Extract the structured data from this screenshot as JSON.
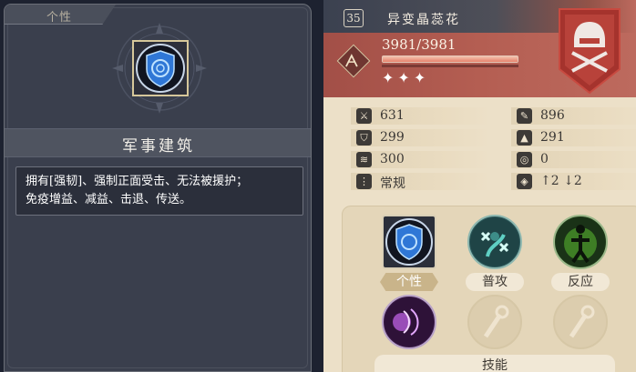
{
  "trait_panel": {
    "tab_label": "个性",
    "name": "军事建筑",
    "description_line1": "拥有[强韧]、强制正面受击、无法被援护；",
    "description_line2": "免疫增益、减益、击退、传送。"
  },
  "unit": {
    "level": "35",
    "name": "异变晶蕊花",
    "hp_text": "3981/3981",
    "hp_fraction": 1.0,
    "stars": "✦✦✦",
    "header_color": "#b45e52"
  },
  "stats": {
    "attack": "631",
    "magic_attack": "896",
    "defense": "299",
    "magic_defense": "291",
    "move": "300",
    "attack_range": "0",
    "move_type": "常规",
    "height_range": "↑2 ↓2"
  },
  "skills": {
    "trait_label": "个性",
    "normal_attack_label": "普攻",
    "reaction_label": "反应",
    "skills_label": "技能"
  }
}
